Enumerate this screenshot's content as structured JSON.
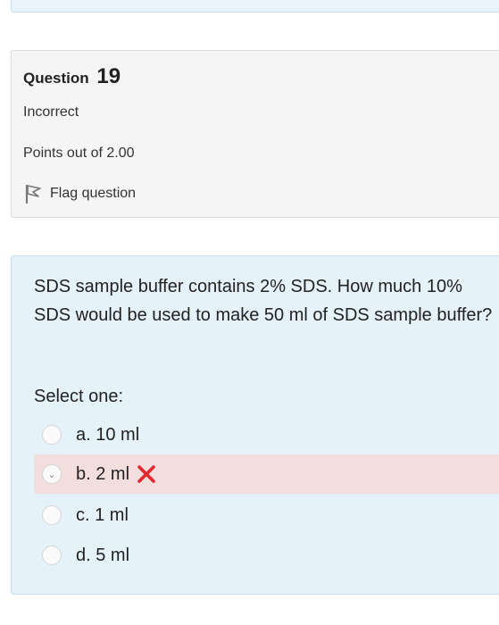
{
  "question": {
    "heading_label": "Question",
    "number": "19",
    "state": "Incorrect",
    "grade": "Points out of 2.00",
    "flag_label": "Flag question"
  },
  "content": {
    "text": "SDS sample buffer contains 2% SDS.  How much 10% SDS would be used to make 50 ml of SDS sample buffer?",
    "prompt": "Select one:",
    "answers": [
      {
        "label": "a. 10 ml",
        "selected": false,
        "status": ""
      },
      {
        "label": "b. 2 ml",
        "selected": true,
        "status": "incorrect"
      },
      {
        "label": "c. 1 ml",
        "selected": false,
        "status": ""
      },
      {
        "label": "d. 5 ml",
        "selected": false,
        "status": ""
      }
    ]
  },
  "colors": {
    "info_bg": "#f5f5f5",
    "content_bg": "#e6f2f9",
    "incorrect_bg": "#f3dede",
    "incorrect_mark": "#e0282e"
  },
  "icons": {
    "flag": "flag-icon",
    "incorrect": "cross-icon",
    "radio": "radio-icon"
  }
}
